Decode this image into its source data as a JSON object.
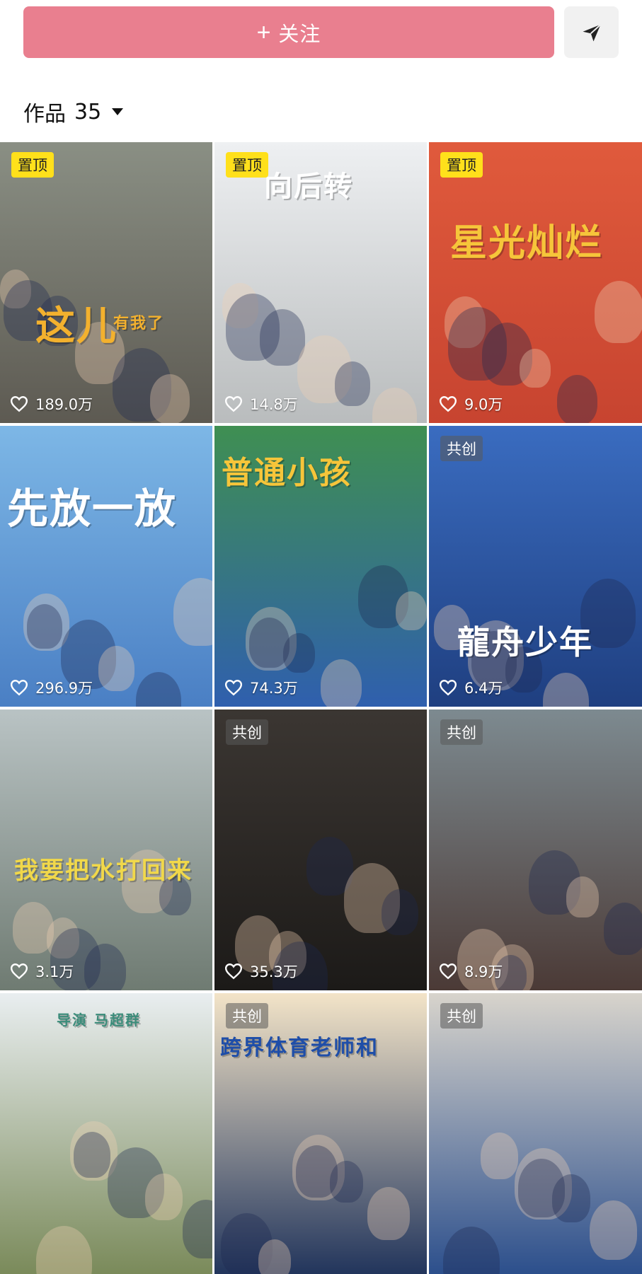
{
  "follow_button": {
    "plus": "+",
    "label": "关注"
  },
  "share": {
    "icon": "send-icon"
  },
  "works": {
    "label": "作品",
    "count": "35",
    "caret_icon": "caret-down-icon"
  },
  "grid": [
    {
      "badge": "置顶",
      "badge_type": "pinned",
      "title": "这儿",
      "subtitle": "有我了",
      "likes": "189.0万",
      "colors": [
        "#8a8f84",
        "#5d5a52"
      ]
    },
    {
      "badge": "置顶",
      "badge_type": "pinned",
      "title": "向后转",
      "likes": "14.8万",
      "colors": [
        "#eef0f2",
        "#b9bcbd"
      ]
    },
    {
      "badge": "置顶",
      "badge_type": "pinned",
      "title": "星光灿烂",
      "likes": "9.0万",
      "colors": [
        "#e05a3c",
        "#c74430"
      ]
    },
    {
      "badge": "",
      "badge_type": "",
      "title": "先放一放",
      "likes": "296.9万",
      "colors": [
        "#7db7e6",
        "#4a7fc4"
      ]
    },
    {
      "badge": "",
      "badge_type": "",
      "title": "普通小孩",
      "likes": "74.3万",
      "colors": [
        "#3f8f52",
        "#2f5fae"
      ]
    },
    {
      "badge": "共创",
      "badge_type": "collab",
      "title": "龍舟少年",
      "likes": "6.4万",
      "colors": [
        "#3a6cc0",
        "#1f3f80"
      ]
    },
    {
      "badge": "",
      "badge_type": "",
      "title": "我要把水打回来",
      "likes": "3.1万",
      "colors": [
        "#b9c3c4",
        "#6f7b72"
      ]
    },
    {
      "badge": "共创",
      "badge_type": "collab",
      "title": "",
      "likes": "35.3万",
      "colors": [
        "#3b3632",
        "#1c1a18"
      ]
    },
    {
      "badge": "共创",
      "badge_type": "collab",
      "title": "",
      "likes": "8.9万",
      "colors": [
        "#7d8a90",
        "#4b3a36"
      ]
    },
    {
      "badge": "",
      "badge_type": "",
      "title": "导演 马超群",
      "likes": "",
      "colors": [
        "#e9eef0",
        "#7a8a5a"
      ]
    },
    {
      "badge": "共创",
      "badge_type": "collab",
      "title": "跨界体育老师和",
      "likes": "",
      "colors": [
        "#f3e4c8",
        "#22355c"
      ]
    },
    {
      "badge": "共创",
      "badge_type": "collab",
      "title": "",
      "likes": "",
      "colors": [
        "#d8d4cc",
        "#2c4f8c"
      ]
    }
  ]
}
